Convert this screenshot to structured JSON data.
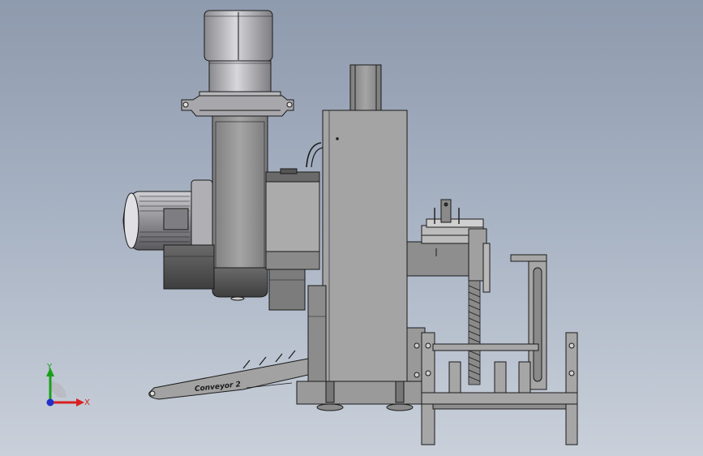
{
  "viewport": {
    "background_top": "#8e9aad",
    "background_bottom": "#c9d0da"
  },
  "model": {
    "part_label": "Conveyor 2",
    "line_color": "#1a1a1a",
    "fill_color": "#9c9c9c",
    "motor_color": "#c8c8cc"
  },
  "triad": {
    "x_label": "X",
    "y_label": "Y",
    "x_color": "#d92020",
    "y_color": "#18a018",
    "z_color": "#2030c8"
  }
}
